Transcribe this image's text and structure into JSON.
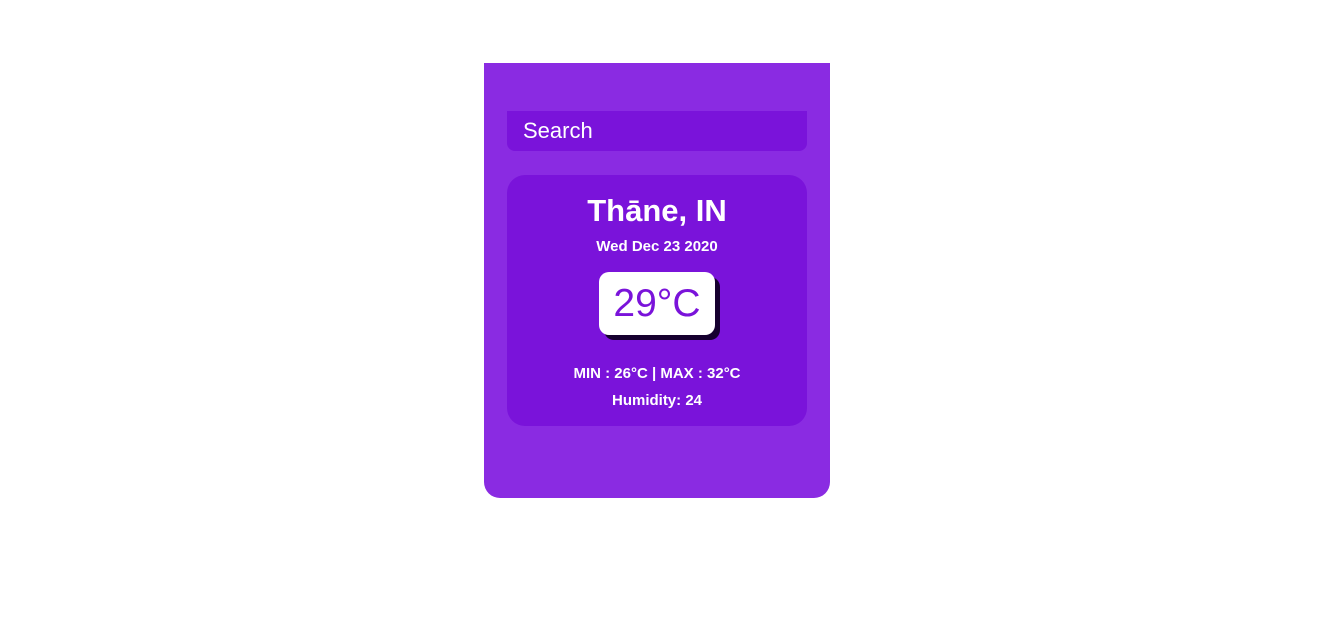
{
  "search": {
    "placeholder": "Search",
    "value": ""
  },
  "weather": {
    "location": "Thāne, IN",
    "date": "Wed Dec 23 2020",
    "temperature": "29°C",
    "min_max": "MIN : 26°C | MAX : 32°C",
    "humidity": "Humidity: 24"
  },
  "colors": {
    "app_background": "#8a2be2",
    "card_background": "#7a13da",
    "temperature_text": "#7a13da",
    "text": "#ffffff"
  }
}
